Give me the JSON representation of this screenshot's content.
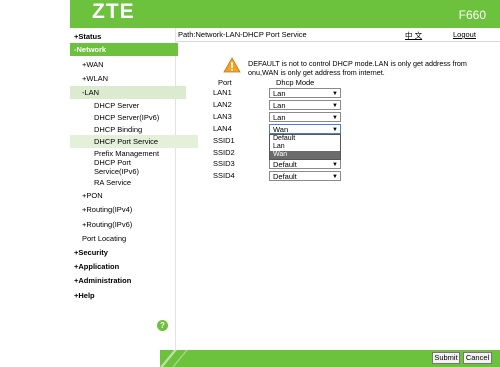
{
  "header": {
    "logo": "ZTE",
    "model": "F660"
  },
  "sidebar": {
    "status": "+Status",
    "network": "-Network",
    "wan": "+WAN",
    "wlan": "+WLAN",
    "lan": "-LAN",
    "dhcp_server": "DHCP Server",
    "dhcp_server_ipv6": "DHCP Server(IPv6)",
    "dhcp_binding": "DHCP Binding",
    "dhcp_port_service": "DHCP Port Service",
    "prefix_management": "Prefix Management",
    "dhcp_port_service_ipv6_line1": "DHCP Port",
    "dhcp_port_service_ipv6_line2": "Service(IPv6)",
    "ra_service": "RA Service",
    "pon": "+PON",
    "routing_ipv4": "+Routing(IPv4)",
    "routing_ipv6": "+Routing(IPv6)",
    "port_locating": "Port Locating",
    "security": "+Security",
    "application": "+Application",
    "administration": "+Administration",
    "help": "+Help",
    "help_icon": "?"
  },
  "topbar": {
    "path": "Path:Network-LAN-DHCP Port Service",
    "language": "中 文",
    "logout": "Logout"
  },
  "notice": "DEFAULT is not to control DHCP mode.LAN is only get address from onu,WAN is only get address from internet.",
  "table": {
    "col_port": "Port",
    "col_mode": "Dhcp Mode",
    "rows": [
      {
        "port": "LAN1",
        "mode": "Lan"
      },
      {
        "port": "LAN2",
        "mode": "Lan"
      },
      {
        "port": "LAN3",
        "mode": "Lan"
      },
      {
        "port": "LAN4",
        "mode": "Wan"
      },
      {
        "port": "SSID1",
        "mode": ""
      },
      {
        "port": "SSID2",
        "mode": ""
      },
      {
        "port": "SSID3",
        "mode": "Default"
      },
      {
        "port": "SSID4",
        "mode": "Default"
      }
    ]
  },
  "dropdown": {
    "options": [
      "Default",
      "Lan",
      "Wan"
    ],
    "highlighted": "Wan"
  },
  "buttons": {
    "submit": "Submit",
    "cancel": "Cancel"
  },
  "colors": {
    "brand_green": "#6cc13d"
  }
}
